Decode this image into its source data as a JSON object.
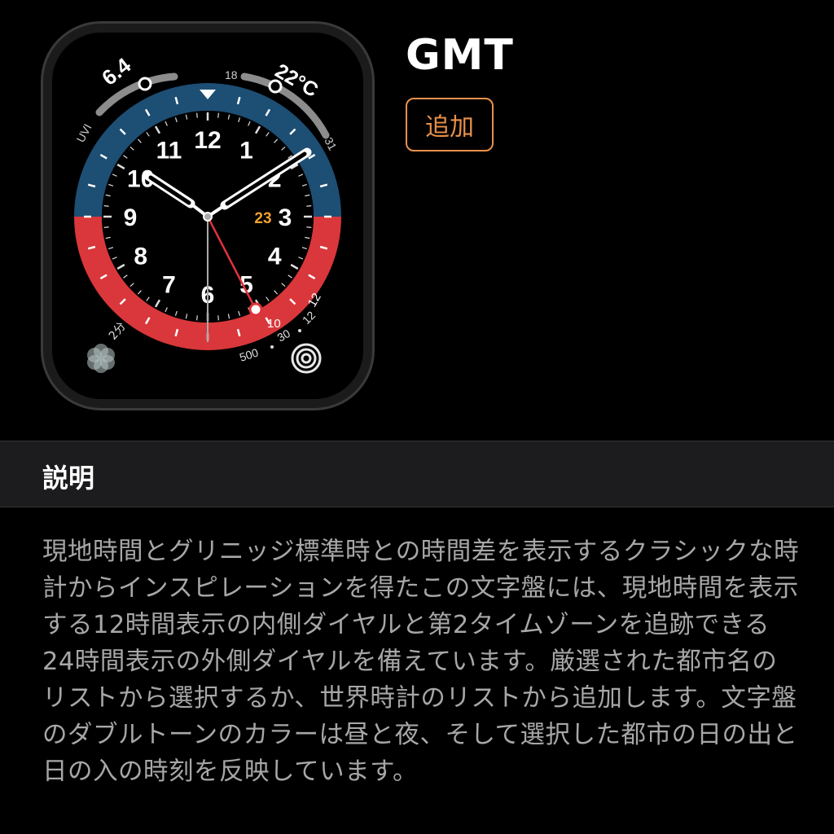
{
  "face": {
    "title": "GMT",
    "add_label": "追加"
  },
  "watch": {
    "uv_value": "6.4",
    "uv_label": "UVI",
    "temp_min": "18",
    "temperature": "22°C",
    "temp_max": "31",
    "date": "23",
    "hour_numerals": [
      "12",
      "1",
      "2",
      "3",
      "4",
      "5",
      "6",
      "7",
      "8",
      "9",
      "10",
      "11"
    ],
    "gmt_bezel_labels": [
      "10",
      "12"
    ],
    "breathe_label": "2分",
    "activity_labels": [
      "500",
      "30",
      "12"
    ],
    "colors": {
      "bezel_day": "#1d4e74",
      "bezel_night": "#d9373b",
      "date_accent": "#f0a030",
      "second_hand": "#e0323a"
    },
    "icons": [
      "breathe-flower-icon",
      "activity-rings-icon"
    ]
  },
  "description": {
    "heading": "説明",
    "body": "現地時間とグリニッジ標準時との時間差を表示するクラシックな時計からインスピレーションを得たこの文字盤には、現地時間を表示する12時間表示の内側ダイヤルと第2タイムゾーンを追跡できる24時間表示の外側ダイヤルを備えています。厳選された都市名のリストから選択するか、世界時計のリストから追加します。文字盤のダブルトーンのカラーは昼と夜、そして選択した都市の日の出と日の入の時刻を反映しています。"
  }
}
